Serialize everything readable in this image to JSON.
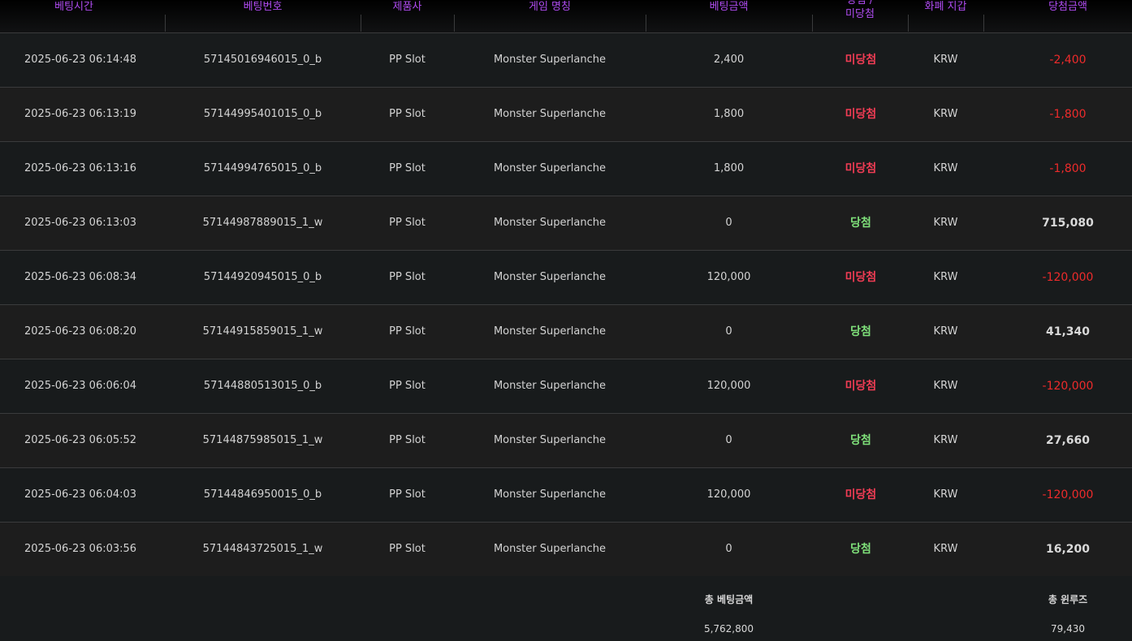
{
  "header": {
    "columns": [
      "베팅시간",
      "베팅번호",
      "제품사",
      "게임 명칭",
      "베팅금액",
      "당첨 / 미당첨",
      "화폐 지갑",
      "당첨금액"
    ],
    "result_line1": "당첨 /",
    "result_line2": "미당첨"
  },
  "rows": [
    {
      "time": "2025-06-23 06:14:48",
      "bet_id": "57145016946015_0_b",
      "provider": "PP Slot",
      "game": "Monster Superlanche",
      "bet_amount": "2,400",
      "status": "미당첨",
      "currency": "KRW",
      "win_amount": "-2,400"
    },
    {
      "time": "2025-06-23 06:13:19",
      "bet_id": "57144995401015_0_b",
      "provider": "PP Slot",
      "game": "Monster Superlanche",
      "bet_amount": "1,800",
      "status": "미당첨",
      "currency": "KRW",
      "win_amount": "-1,800"
    },
    {
      "time": "2025-06-23 06:13:16",
      "bet_id": "57144994765015_0_b",
      "provider": "PP Slot",
      "game": "Monster Superlanche",
      "bet_amount": "1,800",
      "status": "미당첨",
      "currency": "KRW",
      "win_amount": "-1,800"
    },
    {
      "time": "2025-06-23 06:13:03",
      "bet_id": "57144987889015_1_w",
      "provider": "PP Slot",
      "game": "Monster Superlanche",
      "bet_amount": "0",
      "status": "당첨",
      "currency": "KRW",
      "win_amount": "715,080"
    },
    {
      "time": "2025-06-23 06:08:34",
      "bet_id": "57144920945015_0_b",
      "provider": "PP Slot",
      "game": "Monster Superlanche",
      "bet_amount": "120,000",
      "status": "미당첨",
      "currency": "KRW",
      "win_amount": "-120,000"
    },
    {
      "time": "2025-06-23 06:08:20",
      "bet_id": "57144915859015_1_w",
      "provider": "PP Slot",
      "game": "Monster Superlanche",
      "bet_amount": "0",
      "status": "당첨",
      "currency": "KRW",
      "win_amount": "41,340"
    },
    {
      "time": "2025-06-23 06:06:04",
      "bet_id": "57144880513015_0_b",
      "provider": "PP Slot",
      "game": "Monster Superlanche",
      "bet_amount": "120,000",
      "status": "미당첨",
      "currency": "KRW",
      "win_amount": "-120,000"
    },
    {
      "time": "2025-06-23 06:05:52",
      "bet_id": "57144875985015_1_w",
      "provider": "PP Slot",
      "game": "Monster Superlanche",
      "bet_amount": "0",
      "status": "당첨",
      "currency": "KRW",
      "win_amount": "27,660"
    },
    {
      "time": "2025-06-23 06:04:03",
      "bet_id": "57144846950015_0_b",
      "provider": "PP Slot",
      "game": "Monster Superlanche",
      "bet_amount": "120,000",
      "status": "미당첨",
      "currency": "KRW",
      "win_amount": "-120,000"
    },
    {
      "time": "2025-06-23 06:03:56",
      "bet_id": "57144843725015_1_w",
      "provider": "PP Slot",
      "game": "Monster Superlanche",
      "bet_amount": "0",
      "status": "당첨",
      "currency": "KRW",
      "win_amount": "16,200"
    }
  ],
  "footer": {
    "total_bet_label": "총 베팅금액",
    "total_bet_value": "5,762,800",
    "total_winloss_label": "총 윈루즈",
    "total_winloss_value": "79,430"
  },
  "colors": {
    "header_text": "#b04cf2",
    "lose_status": "#f03c54",
    "win_status": "#7fe07a",
    "negative_amount": "#ee2b2b"
  }
}
